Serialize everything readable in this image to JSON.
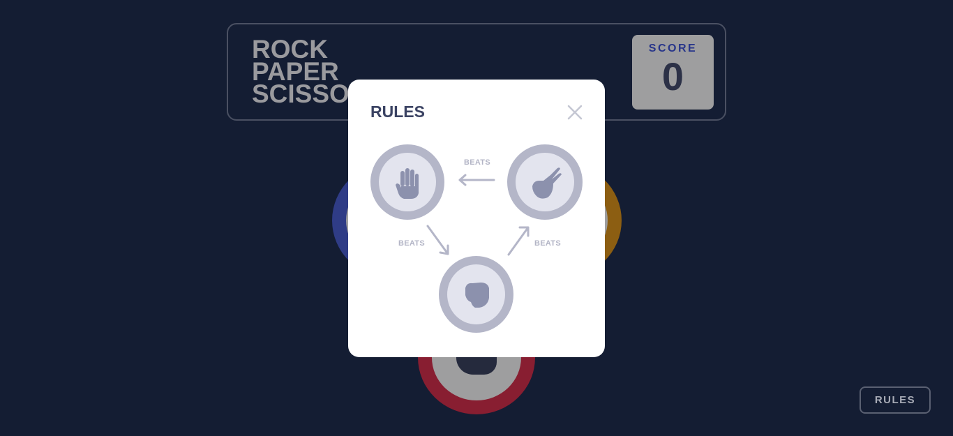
{
  "header": {
    "logo_lines": [
      "ROCK",
      "PAPER",
      "SCISSORS"
    ],
    "score_label": "SCORE",
    "score_value": "0"
  },
  "footer": {
    "rules_button_label": "RULES"
  },
  "modal": {
    "title": "RULES",
    "close_icon": "close-icon",
    "beats_labels": [
      "BEATS",
      "BEATS",
      "BEATS"
    ],
    "tokens": [
      "paper",
      "scissors",
      "rock"
    ]
  },
  "colors": {
    "background": "#141d33",
    "paper": "#2f3c86",
    "scissors": "#8c5e12",
    "rock": "#881e31",
    "modal_bg": "#ffffff",
    "rule_token": "#b4b6c8"
  }
}
